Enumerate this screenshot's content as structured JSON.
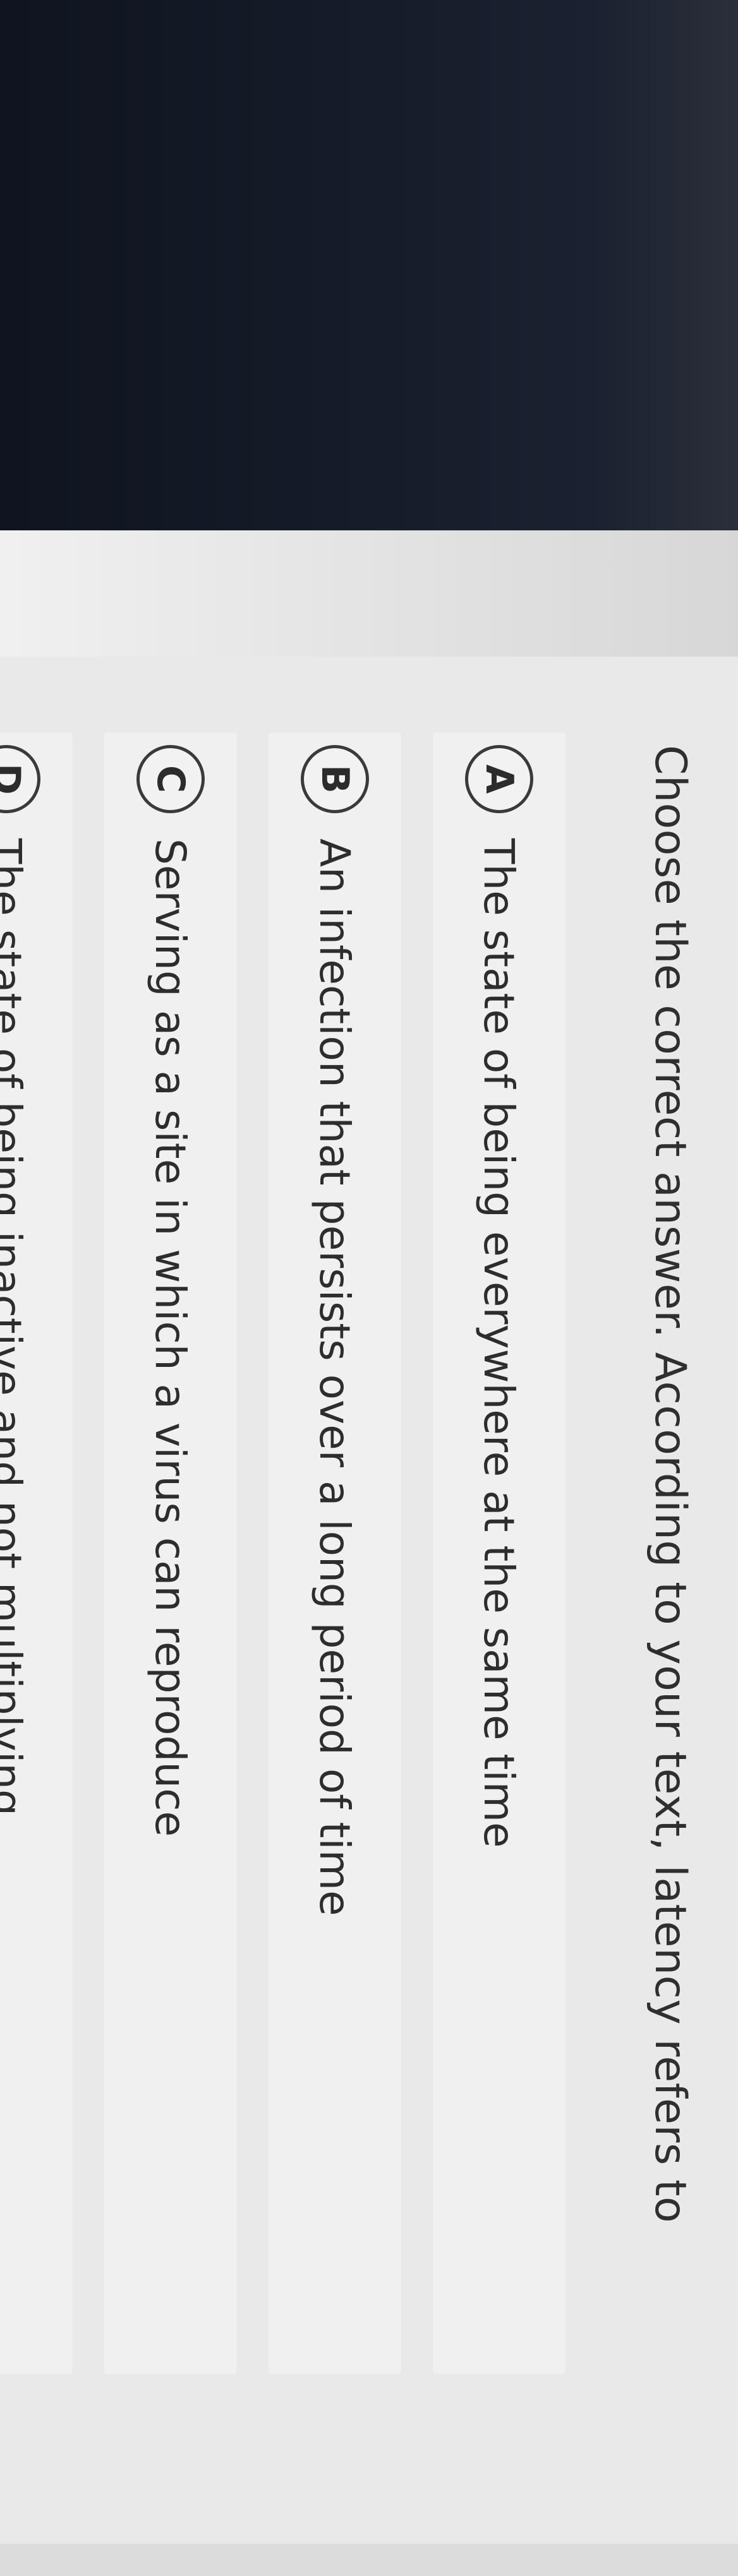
{
  "question": {
    "prompt": "Choose the correct answer. According to your text, latency refers to"
  },
  "options": [
    {
      "letter": "A",
      "text": "The state of being everywhere at the same time"
    },
    {
      "letter": "B",
      "text": "An infection that persists over a long period of time"
    },
    {
      "letter": "C",
      "text": "Serving as a site in which a virus can reproduce"
    },
    {
      "letter": "D",
      "text": "The state of being inactive and not multiplying"
    }
  ],
  "toolbar": {
    "icons": [
      "grid-icon",
      "search-icon",
      "globe-icon",
      "layout-icon"
    ]
  },
  "colors": {
    "dark_band": "#151b28",
    "panel": "#e9e9e9",
    "text": "#2d2d2d"
  }
}
